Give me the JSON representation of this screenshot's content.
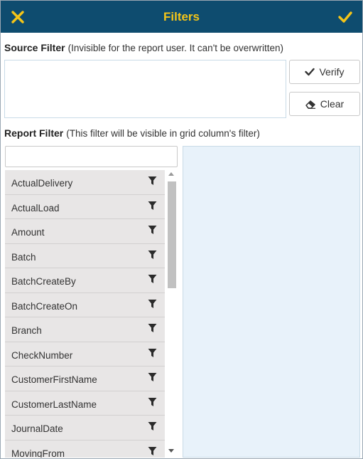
{
  "header": {
    "title": "Filters",
    "close_icon": "x-icon",
    "confirm_icon": "checkmark-icon",
    "accent_color": "#f5c518",
    "bar_color": "#0e4c6f"
  },
  "source_filter": {
    "label": "Source Filter",
    "hint": "(Invisible for the report user. It can't be overwritten)",
    "value": "",
    "verify_label": "Verify",
    "clear_label": "Clear"
  },
  "report_filter": {
    "label": "Report Filter",
    "hint": "(This filter will be visible in grid column's filter)",
    "search_value": "",
    "fields": [
      "ActualDelivery",
      "ActualLoad",
      "Amount",
      "Batch",
      "BatchCreateBy",
      "BatchCreateOn",
      "Branch",
      "CheckNumber",
      "CustomerFirstName",
      "CustomerLastName",
      "JournalDate",
      "MovingFrom"
    ]
  }
}
